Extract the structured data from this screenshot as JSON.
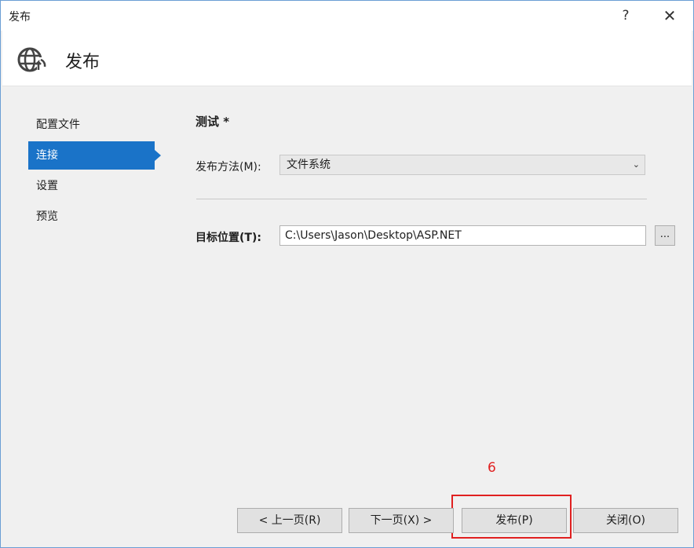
{
  "window": {
    "title": "发布",
    "help_label": "?",
    "close_label": "✕"
  },
  "header": {
    "title": "发布",
    "icon": "globe-publish-icon"
  },
  "nav": {
    "items": [
      {
        "label": "配置文件",
        "active": false
      },
      {
        "label": "连接",
        "active": true
      },
      {
        "label": "设置",
        "active": false
      },
      {
        "label": "预览",
        "active": false
      }
    ]
  },
  "main": {
    "section_title": "测试 *",
    "method_label": "发布方法(M):",
    "method_value": "文件系统",
    "target_label": "目标位置(T):",
    "target_value": "C:\\Users\\Jason\\Desktop\\ASP.NET",
    "browse_label": "..."
  },
  "footer": {
    "prev_label": "< 上一页(R)",
    "next_label": "下一页(X) >",
    "publish_label": "发布(P)",
    "close_label": "关闭(O)"
  },
  "annotation": {
    "text": "6",
    "color": "#e02020"
  },
  "colors": {
    "accent": "#1a73c8",
    "highlight": "#e02020"
  }
}
